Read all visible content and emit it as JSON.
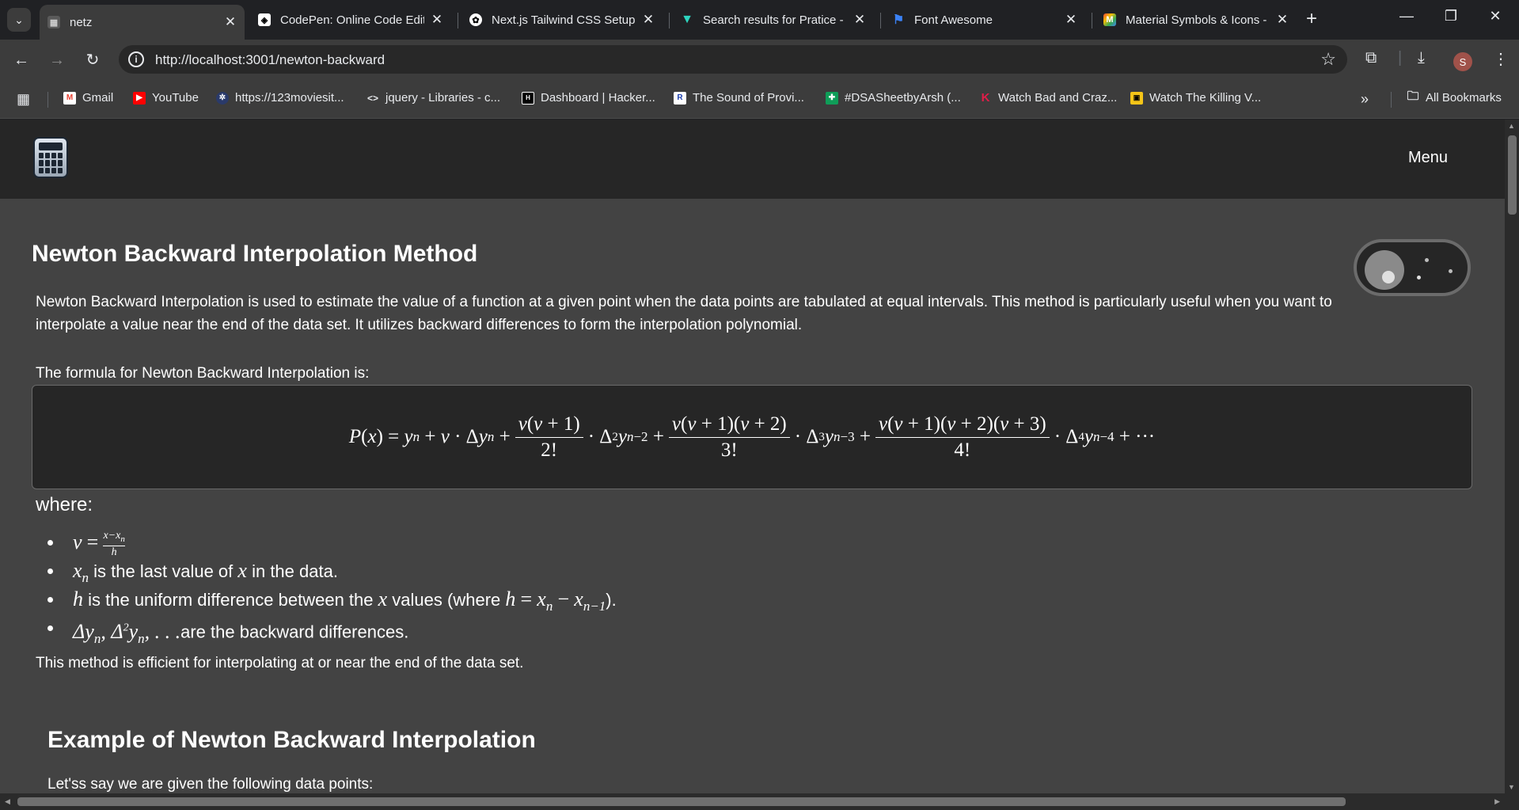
{
  "browser": {
    "tabs": [
      {
        "title": "netz",
        "active": true,
        "favicon": "page-icon"
      },
      {
        "title": "CodePen: Online Code Editor",
        "favicon": "codepen-icon"
      },
      {
        "title": "Next.js Tailwind CSS Setup",
        "favicon": "openai-icon"
      },
      {
        "title": "Search results for Pratice -",
        "favicon": "vercel-icon"
      },
      {
        "title": "Font Awesome",
        "favicon": "flag-icon"
      },
      {
        "title": "Material Symbols & Icons -",
        "favicon": "material-icon"
      }
    ],
    "url": "http://localhost:3001/newton-backward",
    "profile_initial": "S",
    "bookmarks": [
      {
        "label": "Gmail",
        "icon": "gmail-icon"
      },
      {
        "label": "YouTube",
        "icon": "youtube-icon"
      },
      {
        "label": "https://123moviesit...",
        "icon": "film-reel-icon"
      },
      {
        "label": "jquery - Libraries - c...",
        "icon": "code-icon"
      },
      {
        "label": "Dashboard | Hacker...",
        "icon": "hackerrank-icon"
      },
      {
        "label": "The Sound of Provi...",
        "icon": "r-icon"
      },
      {
        "label": "#DSASheetbyArsh (...",
        "icon": "sheets-icon"
      },
      {
        "label": "Watch Bad and Craz...",
        "icon": "k-icon"
      },
      {
        "label": "Watch The Killing V...",
        "icon": "tv-icon"
      }
    ],
    "all_bookmarks": "All Bookmarks"
  },
  "app": {
    "menu_label": "Menu",
    "title": "Newton Backward Interpolation Method",
    "intro": "Newton Backward Interpolation is used to estimate the value of a function at a given point when the data points are tabulated at equal intervals. This method is particularly useful when you want to interpolate a value near the end of the data set. It utilizes backward differences to form the interpolation polynomial.",
    "formula_intro": "The formula for Newton Backward Interpolation is:",
    "where": "where:",
    "bullet_texts": {
      "xn": "is the last value of",
      "xn_tail": "in the data.",
      "h": "is the uniform difference between the",
      "h_mid": "values (where",
      "diff": "are the backward differences."
    },
    "conclusion": "This method is efficient for interpolating at or near the end of the data set.",
    "example_title": "Example of Newton Backward Interpolation",
    "example_intro": "Let'ss say we are given the following data points:"
  },
  "colors": {
    "page_bg": "#434343",
    "nav_bg": "#262626",
    "chrome_bg": "#202124",
    "toolbar_bg": "#3c3c3c"
  }
}
